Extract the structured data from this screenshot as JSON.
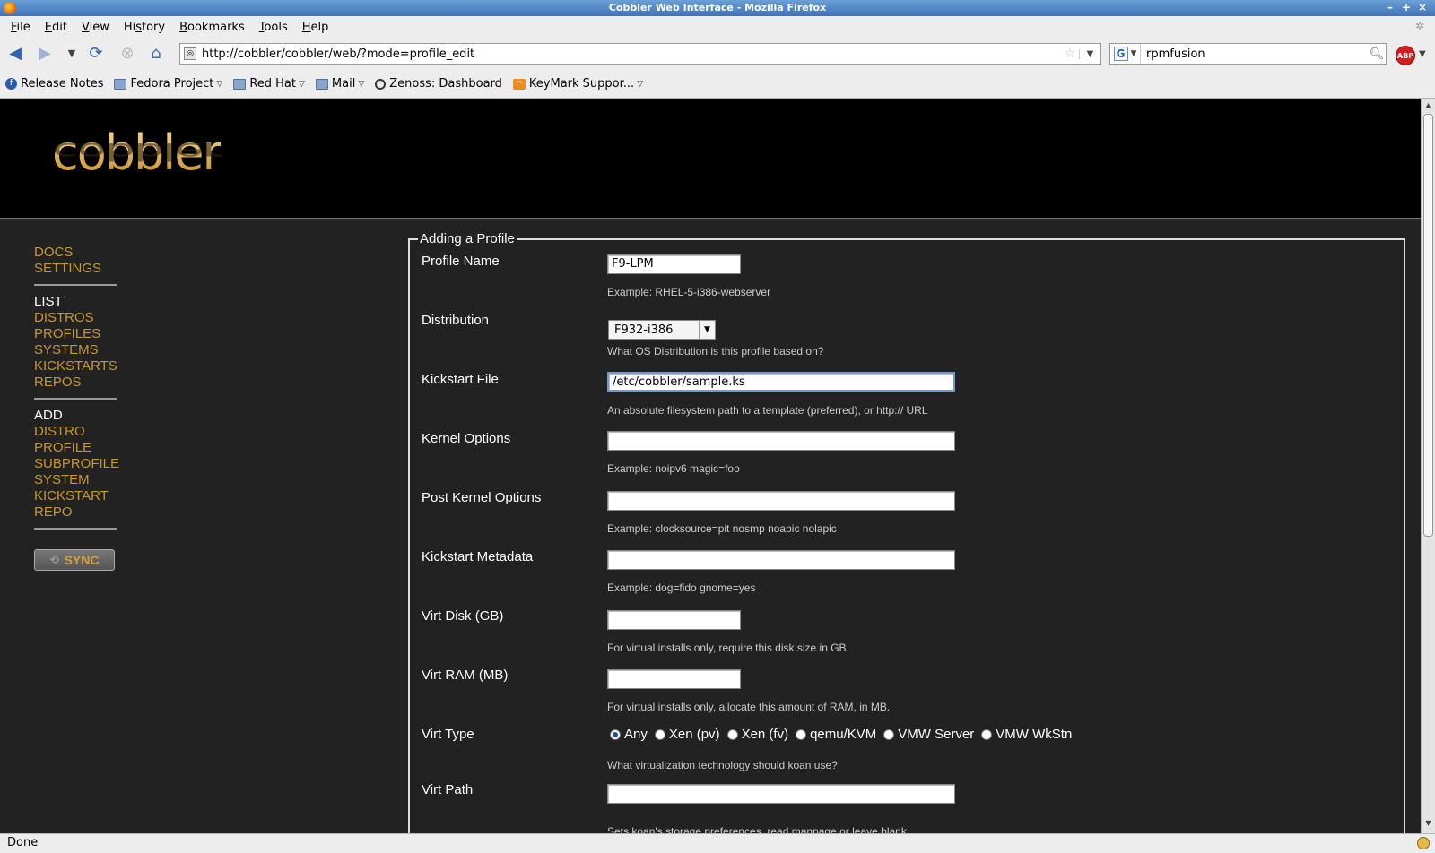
{
  "window": {
    "title": "Cobbler Web Interface - Mozilla Firefox",
    "buttons": [
      "–",
      "+",
      "×"
    ]
  },
  "menu": {
    "items": [
      {
        "u": "F",
        "rest": "ile"
      },
      {
        "u": "E",
        "rest": "dit"
      },
      {
        "u": "V",
        "rest": "iew"
      },
      {
        "pre": "Hi",
        "u": "s",
        "rest": "tory"
      },
      {
        "u": "B",
        "rest": "ookmarks"
      },
      {
        "u": "T",
        "rest": "ools"
      },
      {
        "u": "H",
        "rest": "elp"
      }
    ]
  },
  "navbar": {
    "url": "http://cobbler/cobbler/web/?mode=profile_edit",
    "search_value": "rpmfusion",
    "search_engine_letter": "G",
    "abp_label": "ABP"
  },
  "bookmarks": [
    {
      "label": "Release Notes",
      "icon": "fedora-icon",
      "dropdown": false
    },
    {
      "label": "Fedora Project",
      "icon": "folder-icon",
      "dropdown": true
    },
    {
      "label": "Red Hat",
      "icon": "folder-icon",
      "dropdown": true
    },
    {
      "label": "Mail",
      "icon": "folder-icon",
      "dropdown": true
    },
    {
      "label": "Zenoss: Dashboard",
      "icon": "zenoss-icon",
      "dropdown": false
    },
    {
      "label": "KeyMark Suppor...",
      "icon": "rss-icon",
      "dropdown": true
    }
  ],
  "page": {
    "logo_text": "cobbler",
    "sidebar": {
      "top_links": [
        "DOCS",
        "SETTINGS"
      ],
      "list_heading": "LIST",
      "list_links": [
        "DISTROS",
        "PROFILES",
        "SYSTEMS",
        "KICKSTARTS",
        "REPOS"
      ],
      "add_heading": "ADD",
      "add_links": [
        "DISTRO",
        "PROFILE",
        "SUBPROFILE",
        "SYSTEM",
        "KICKSTART",
        "REPO"
      ],
      "sync_label": "SYNC"
    },
    "form": {
      "legend": "Adding a Profile",
      "profile_name": {
        "label": "Profile Name",
        "value": "F9-LPM",
        "hint": "Example: RHEL-5-i386-webserver"
      },
      "distribution": {
        "label": "Distribution",
        "value": "F932-i386",
        "hint": "What OS Distribution is this profile based on?"
      },
      "kickstart_file": {
        "label": "Kickstart File",
        "value": "/etc/cobbler/sample.ks",
        "hint": "An absolute filesystem path to a template (preferred), or http:// URL"
      },
      "kernel_options": {
        "label": "Kernel Options",
        "value": "",
        "hint": "Example: noipv6 magic=foo"
      },
      "post_kernel_options": {
        "label": "Post Kernel Options",
        "value": "",
        "hint": "Example: clocksource=pit nosmp noapic nolapic"
      },
      "kickstart_metadata": {
        "label": "Kickstart Metadata",
        "value": "",
        "hint": "Example: dog=fido gnome=yes"
      },
      "virt_disk": {
        "label": "Virt Disk (GB)",
        "value": "",
        "hint": "For virtual installs only, require this disk size in GB."
      },
      "virt_ram": {
        "label": "Virt RAM (MB)",
        "value": "",
        "hint": "For virtual installs only, allocate this amount of RAM, in MB."
      },
      "virt_type": {
        "label": "Virt Type",
        "options": [
          "Any",
          "Xen (pv)",
          "Xen (fv)",
          "qemu/KVM",
          "VMW Server",
          "VMW WkStn"
        ],
        "selected": "Any",
        "hint": "What virtualization technology should koan use?"
      },
      "virt_path": {
        "label": "Virt Path",
        "value": "",
        "hint": "Sets koan's storage preferences, read manpage or leave blank."
      }
    }
  },
  "status": {
    "text": "Done"
  }
}
